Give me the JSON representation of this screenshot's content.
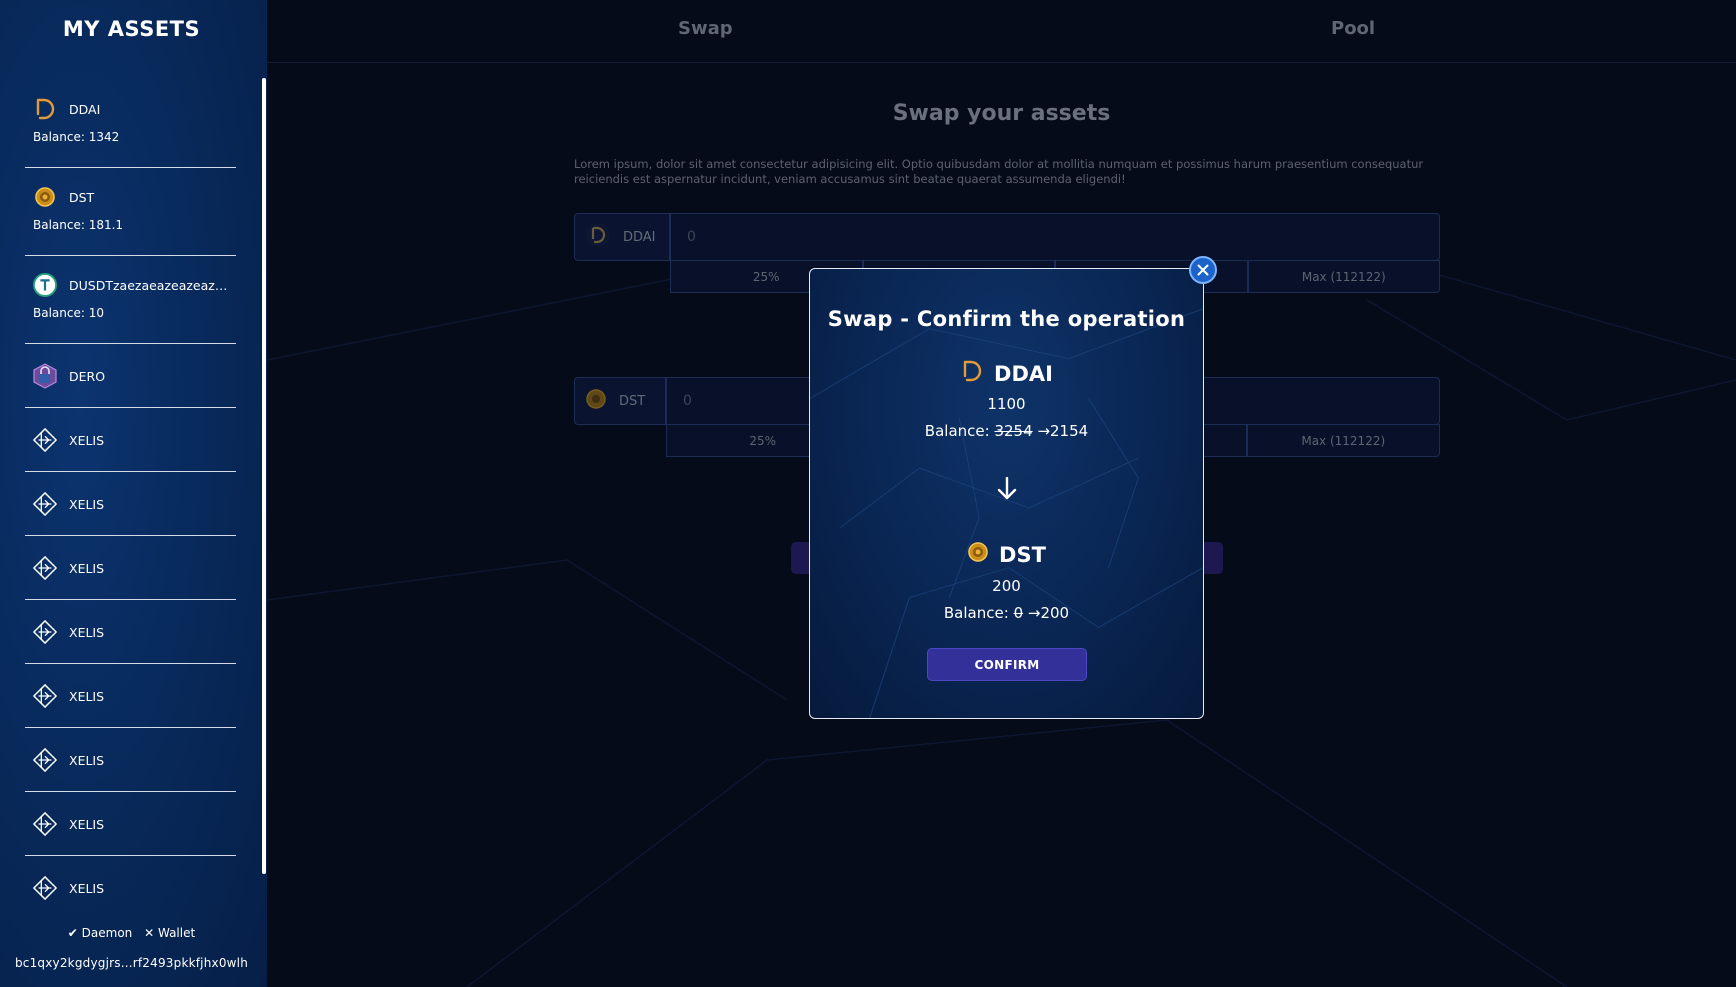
{
  "sidebar": {
    "title": "MY ASSETS",
    "assets": [
      {
        "name": "DDAI",
        "icon": "ddai-icon",
        "balance": "Balance: 1342"
      },
      {
        "name": "DST",
        "icon": "dst-coin-icon",
        "balance": "Balance: 181.1"
      },
      {
        "name": "DUSDTzaezaeazeazeazeazea",
        "icon": "tether-icon",
        "balance": "Balance: 10"
      },
      {
        "name": "DERO",
        "icon": "dero-icon"
      },
      {
        "name": "XELIS",
        "icon": "xelis-icon"
      },
      {
        "name": "XELIS",
        "icon": "xelis-icon"
      },
      {
        "name": "XELIS",
        "icon": "xelis-icon"
      },
      {
        "name": "XELIS",
        "icon": "xelis-icon"
      },
      {
        "name": "XELIS",
        "icon": "xelis-icon"
      },
      {
        "name": "XELIS",
        "icon": "xelis-icon"
      },
      {
        "name": "XELIS",
        "icon": "xelis-icon"
      },
      {
        "name": "XELIS",
        "icon": "xelis-icon"
      }
    ],
    "status": {
      "daemon": "✔ Daemon",
      "wallet": "✕ Wallet"
    },
    "wallet_address": "bc1qxy2kgdygjrs...rf2493pkkfjhx0wlh"
  },
  "tabs": {
    "swap": "Swap",
    "pool": "Pool"
  },
  "swap": {
    "title": "Swap your assets",
    "description": "Lorem ipsum, dolor sit amet consectetur adipisicing elit. Optio quibusdam dolor at mollitia numquam et possimus harum praesentium consequatur reiciendis est aspernatur incidunt, veniam accusamus sint beatae quaerat assumenda eligendi!",
    "from": {
      "token": "DDAI",
      "amount_placeholder": "0",
      "pct_25": "25%",
      "max": "Max (112122)"
    },
    "to": {
      "token": "DST",
      "amount_placeholder": "0",
      "pct_25": "25%",
      "max": "Max (112122)"
    }
  },
  "modal": {
    "title": "Swap - Confirm the operation",
    "from": {
      "token": "DDAI",
      "amount": "1100",
      "balance_label": "Balance:",
      "old_balance": "3254",
      "new_balance": "2154"
    },
    "to": {
      "token": "DST",
      "amount": "200",
      "balance_label": "Balance:",
      "old_balance": "0",
      "new_balance": "200"
    },
    "confirm_label": "CONFIRM"
  },
  "colors": {
    "accent": "#33309a",
    "close": "#1b63c9",
    "sidebar": "#082a5c",
    "ddai": "#e39a3a",
    "dst": "#d4a020"
  }
}
